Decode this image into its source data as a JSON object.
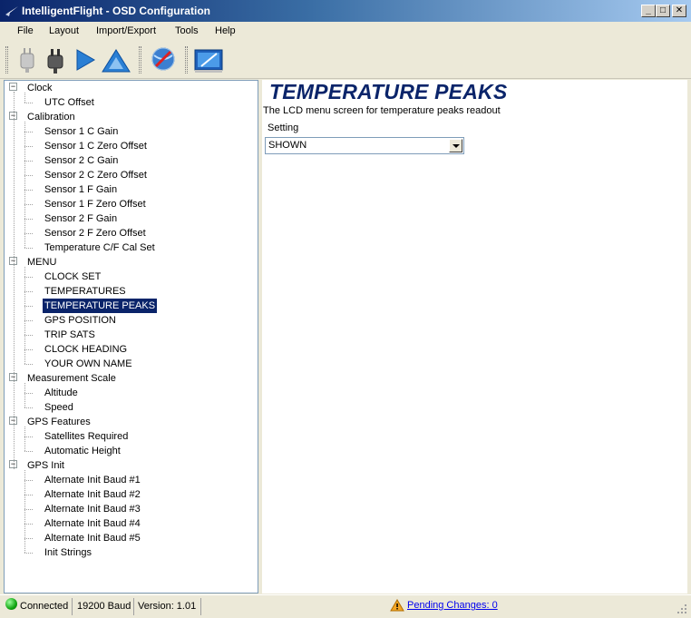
{
  "window": {
    "title": "IntelligentFlight - OSD Configuration",
    "minimize_label": "_",
    "maximize_label": "□",
    "close_label": "✕"
  },
  "menu": [
    "File",
    "Layout",
    "Import/Export",
    "Tools",
    "Help"
  ],
  "toolbar": {
    "icons": [
      "disconnect-plug-icon",
      "connect-plug-icon",
      "send-arrow-icon",
      "upload-triangle-icon",
      "globe-search-icon",
      "display-pen-icon"
    ]
  },
  "tree": {
    "groups": [
      {
        "label": "Clock",
        "children": [
          "UTC Offset"
        ]
      },
      {
        "label": "Calibration",
        "children": [
          "Sensor 1 C Gain",
          "Sensor 1 C Zero Offset",
          "Sensor 2 C Gain",
          "Sensor 2 C Zero Offset",
          "Sensor 1 F Gain",
          "Sensor 1 F Zero Offset",
          "Sensor 2 F Gain",
          "Sensor 2 F Zero Offset",
          "Temperature C/F Cal Set"
        ]
      },
      {
        "label": "MENU",
        "children": [
          "CLOCK SET",
          "TEMPERATURES",
          "TEMPERATURE PEAKS",
          "GPS POSITION",
          "TRIP SATS",
          "CLOCK HEADING",
          "YOUR OWN NAME"
        ]
      },
      {
        "label": "Measurement Scale",
        "children": [
          "Altitude",
          "Speed"
        ]
      },
      {
        "label": "GPS Features",
        "children": [
          "Satellites Required",
          "Automatic Height"
        ]
      },
      {
        "label": "GPS Init",
        "children": [
          "Alternate Init Baud #1",
          "Alternate Init Baud #2",
          "Alternate Init Baud #3",
          "Alternate Init Baud #4",
          "Alternate Init Baud #5",
          "Init Strings"
        ]
      }
    ],
    "selected": "TEMPERATURE PEAKS",
    "expander_symbol": "−"
  },
  "content": {
    "title": "TEMPERATURE PEAKS",
    "description": "The LCD menu screen for temperature peaks readout",
    "setting_label": "Setting",
    "setting_value": "SHOWN"
  },
  "status": {
    "connection": "Connected",
    "baud": "19200 Baud",
    "version": "Version: 1.01",
    "pending": "Pending Changes: 0"
  },
  "colors": {
    "selection": "#0a246a",
    "title_text": "#0a246a",
    "link": "#0000ee",
    "connected_led": "#11a511",
    "warning": "#f5a623"
  }
}
